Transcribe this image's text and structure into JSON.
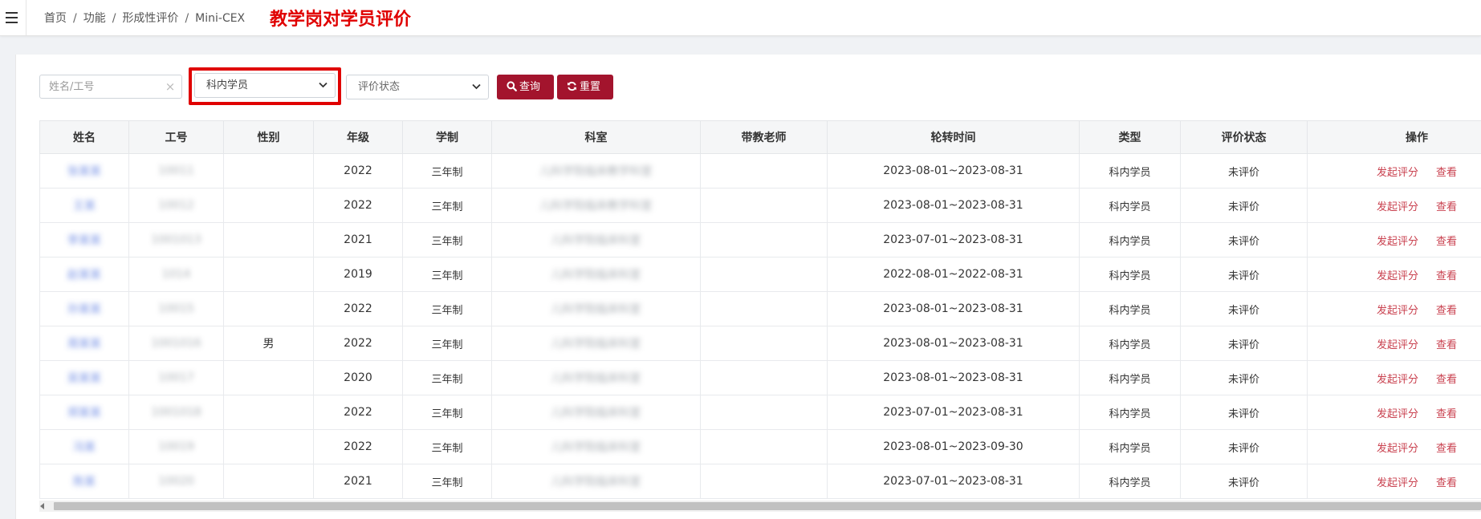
{
  "breadcrumb": [
    "首页",
    "功能",
    "形成性评价",
    "Mini-CEX"
  ],
  "breadcrumb_separator": "/",
  "annotation": "教学岗对学员评价",
  "filters": {
    "name_placeholder": "姓名/工号",
    "clear_symbol": "×",
    "type_select": "科内学员",
    "status_select_placeholder": "评价状态",
    "query_label": "查询",
    "reset_label": "重置"
  },
  "colors": {
    "primary_button": "#a3142d",
    "action_link": "#c9414f",
    "annotation_red": "#e00000"
  },
  "table": {
    "headers": [
      "姓名",
      "工号",
      "性别",
      "年级",
      "学制",
      "科室",
      "带教老师",
      "轮转时间",
      "类型",
      "评价状态",
      "操作"
    ],
    "rows": [
      {
        "name": "张某某",
        "id": "10011",
        "gender": "",
        "grade": "2022",
        "system": "三年制",
        "dept": "儿科学院临床教学科室",
        "teacher": "",
        "rotation": "2023-08-01~2023-08-31",
        "type": "科内学员",
        "status": "未评价",
        "action1": "发起评分",
        "action2": "查看"
      },
      {
        "name": "王某",
        "id": "10012",
        "gender": "",
        "grade": "2022",
        "system": "三年制",
        "dept": "儿科学院临床教学科室",
        "teacher": "",
        "rotation": "2023-08-01~2023-08-31",
        "type": "科内学员",
        "status": "未评价",
        "action1": "发起评分",
        "action2": "查看"
      },
      {
        "name": "李某某",
        "id": "1001013",
        "gender": "",
        "grade": "2021",
        "system": "三年制",
        "dept": "儿科学院临床科室",
        "teacher": "",
        "rotation": "2023-07-01~2023-08-31",
        "type": "科内学员",
        "status": "未评价",
        "action1": "发起评分",
        "action2": "查看"
      },
      {
        "name": "赵某某",
        "id": "1014",
        "gender": "",
        "grade": "2019",
        "system": "三年制",
        "dept": "儿科学院临床科室",
        "teacher": "",
        "rotation": "2022-08-01~2022-08-31",
        "type": "科内学员",
        "status": "未评价",
        "action1": "发起评分",
        "action2": "查看"
      },
      {
        "name": "孙某某",
        "id": "10015",
        "gender": "",
        "grade": "2022",
        "system": "三年制",
        "dept": "儿科学院临床科室",
        "teacher": "",
        "rotation": "2023-08-01~2023-08-31",
        "type": "科内学员",
        "status": "未评价",
        "action1": "发起评分",
        "action2": "查看"
      },
      {
        "name": "周某某",
        "id": "1001016",
        "gender": "男",
        "grade": "2022",
        "system": "三年制",
        "dept": "儿科学院临床科室",
        "teacher": "",
        "rotation": "2023-08-01~2023-08-31",
        "type": "科内学员",
        "status": "未评价",
        "action1": "发起评分",
        "action2": "查看"
      },
      {
        "name": "吴某某",
        "id": "10017",
        "gender": "",
        "grade": "2020",
        "system": "三年制",
        "dept": "儿科学院临床科室",
        "teacher": "",
        "rotation": "2023-08-01~2023-08-31",
        "type": "科内学员",
        "status": "未评价",
        "action1": "发起评分",
        "action2": "查看"
      },
      {
        "name": "郑某某",
        "id": "1001018",
        "gender": "",
        "grade": "2022",
        "system": "三年制",
        "dept": "儿科学院临床科室",
        "teacher": "",
        "rotation": "2023-07-01~2023-08-31",
        "type": "科内学员",
        "status": "未评价",
        "action1": "发起评分",
        "action2": "查看"
      },
      {
        "name": "冯某",
        "id": "10019",
        "gender": "",
        "grade": "2022",
        "system": "三年制",
        "dept": "儿科学院临床科室",
        "teacher": "",
        "rotation": "2023-08-01~2023-09-30",
        "type": "科内学员",
        "status": "未评价",
        "action1": "发起评分",
        "action2": "查看"
      },
      {
        "name": "陈某",
        "id": "10020",
        "gender": "",
        "grade": "2021",
        "system": "三年制",
        "dept": "儿科学院临床科室",
        "teacher": "",
        "rotation": "2023-07-01~2023-08-31",
        "type": "科内学员",
        "status": "未评价",
        "action1": "发起评分",
        "action2": "查看"
      }
    ]
  }
}
